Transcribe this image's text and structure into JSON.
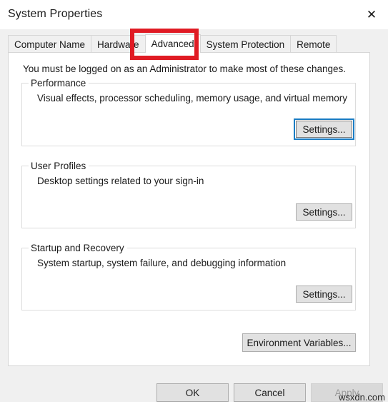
{
  "window": {
    "title": "System Properties",
    "close_icon": "close-icon",
    "close_label": "✕"
  },
  "tabs": [
    {
      "label": "Computer Name",
      "active": false
    },
    {
      "label": "Hardware",
      "active": false
    },
    {
      "label": "Advanced",
      "active": true
    },
    {
      "label": "System Protection",
      "active": false
    },
    {
      "label": "Remote",
      "active": false
    }
  ],
  "content": {
    "admin_note": "You must be logged on as an Administrator to make most of these changes.",
    "groups": [
      {
        "legend": "Performance",
        "description": "Visual effects, processor scheduling, memory usage, and virtual memory",
        "button_label": "Settings...",
        "button_focused": true
      },
      {
        "legend": "User Profiles",
        "description": "Desktop settings related to your sign-in",
        "button_label": "Settings...",
        "button_focused": false
      },
      {
        "legend": "Startup and Recovery",
        "description": "System startup, system failure, and debugging information",
        "button_label": "Settings...",
        "button_focused": false
      }
    ],
    "environment_variables_label": "Environment Variables..."
  },
  "commands": {
    "ok_label": "OK",
    "cancel_label": "Cancel",
    "apply_label": "Apply",
    "apply_disabled": true
  },
  "annotation": {
    "target": "Advanced",
    "color": "#e01b24"
  },
  "watermark": {
    "text": "wsxdn.com"
  },
  "colors": {
    "accent_focus": "#1b7dc4",
    "dialog_background": "#f0f0f0",
    "panel_background": "#ffffff",
    "button_face": "#e1e1e1"
  }
}
